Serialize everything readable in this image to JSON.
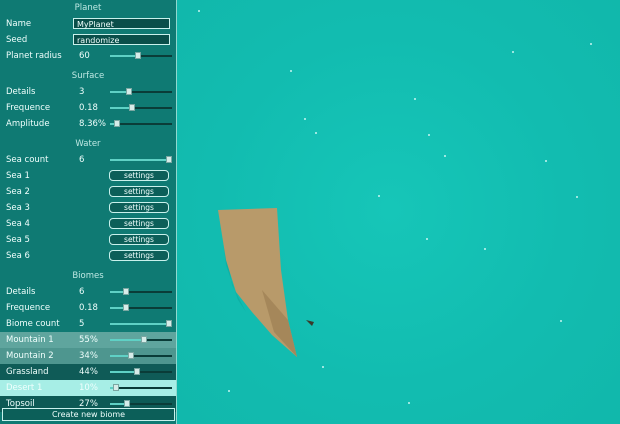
{
  "planet_section": {
    "title": "Planet",
    "name_label": "Name",
    "name_value": "MyPlanet",
    "seed_label": "Seed",
    "seed_value": "randomize",
    "radius_label": "Planet radius",
    "radius_value": "60",
    "radius_fraction": 0.45
  },
  "surface_section": {
    "title": "Surface",
    "rows": [
      {
        "label": "Details",
        "value": "3",
        "fraction": 0.3
      },
      {
        "label": "Frequence",
        "value": "0.18",
        "fraction": 0.35
      },
      {
        "label": "Amplitude",
        "value": "8.36%",
        "fraction": 0.12
      }
    ]
  },
  "water_section": {
    "title": "Water",
    "sea_count_label": "Sea count",
    "sea_count_value": "6",
    "sea_count_fraction": 0.95,
    "button_label": "settings",
    "seas": [
      "Sea 1",
      "Sea 2",
      "Sea 3",
      "Sea 4",
      "Sea 5",
      "Sea 6"
    ]
  },
  "biomes_section": {
    "title": "Biomes",
    "rows": [
      {
        "label": "Details",
        "value": "6",
        "fraction": 0.25
      },
      {
        "label": "Frequence",
        "value": "0.18",
        "fraction": 0.25
      },
      {
        "label": "Biome count",
        "value": "5",
        "fraction": 0.95
      }
    ],
    "biomes": [
      {
        "label": "Mountain 1",
        "value": "55%",
        "fraction": 0.55,
        "color": "#5fa59e"
      },
      {
        "label": "Mountain 2",
        "value": "34%",
        "fraction": 0.34,
        "color": "#4e968f"
      },
      {
        "label": "Grassland",
        "value": "44%",
        "fraction": 0.44,
        "color": "#0f5b57"
      },
      {
        "label": "Desert 1",
        "value": "10%",
        "fraction": 0.1,
        "color": "#a7eee6"
      },
      {
        "label": "Topsoil",
        "value": "27%",
        "fraction": 0.27,
        "color": "#0d5a55"
      }
    ],
    "create_label": "Create new biome"
  },
  "colors": {
    "background": "#12bcb0",
    "panel": "#0f7a73",
    "planet_fragment": "#b89a6a"
  }
}
